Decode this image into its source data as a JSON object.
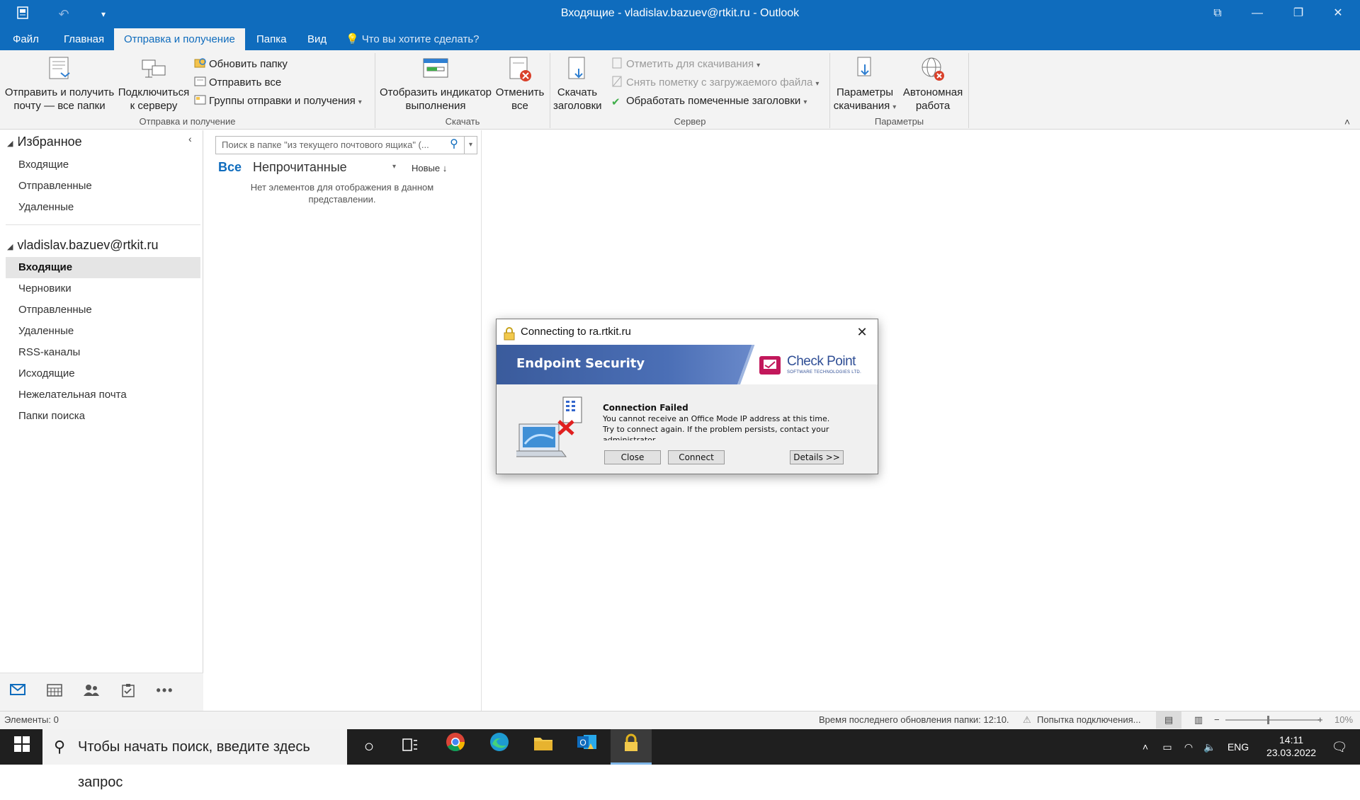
{
  "window": {
    "title": "Входящие - vladislav.bazuev@rtkit.ru - Outlook"
  },
  "ribbon_tabs": [
    {
      "label": "Файл"
    },
    {
      "label": "Главная"
    },
    {
      "label": "Отправка и получение",
      "active": true
    },
    {
      "label": "Папка"
    },
    {
      "label": "Вид"
    }
  ],
  "tell_me": "Что вы хотите сделать?",
  "ribbon": {
    "send_receive_all": "Отправить и получить почту — все папки",
    "send_receive_all_l1": "Отправить и получить",
    "send_receive_all_l2": "почту — все папки",
    "connect_l1": "Подключиться",
    "connect_l2": "к серверу",
    "update_folder": "Обновить папку",
    "send_all": "Отправить все",
    "send_groups": "Группы отправки и получения",
    "group_send_receive": "Отправка и получение",
    "show_progress_l1": "Отобразить индикатор",
    "show_progress_l2": "выполнения",
    "cancel_all_l1": "Отменить",
    "cancel_all_l2": "все",
    "group_download": "Скачать",
    "download_headers_l1": "Скачать",
    "download_headers_l2": "заголовки",
    "mark_download": "Отметить для скачивания",
    "unmark_download": "Снять пометку с загружаемого файла",
    "process_headers": "Обработать помеченные заголовки",
    "group_server": "Сервер",
    "download_prefs_l1": "Параметры",
    "download_prefs_l2": "скачивания",
    "work_offline_l1": "Автономная",
    "work_offline_l2": "работа",
    "group_params": "Параметры"
  },
  "nav": {
    "favorites_header": "Избранное",
    "favorites": [
      "Входящие",
      "Отправленные",
      "Удаленные"
    ],
    "account_header": "vladislav.bazuev@rtkit.ru",
    "folders": [
      "Входящие",
      "Черновики",
      "Отправленные",
      "Удаленные",
      "RSS-каналы",
      "Исходящие",
      "Нежелательная почта",
      "Папки поиска"
    ],
    "selected": "Входящие"
  },
  "msglist": {
    "search_placeholder": "Поиск в папке \"из текущего почтового ящика\" (...",
    "filter_all": "Все",
    "filter_unread": "Непрочитанные",
    "sort": "Новые",
    "empty_text": "Нет элементов для отображения в данном представлении."
  },
  "dialog": {
    "title": "Connecting to ra.rtkit.ru",
    "banner_left": "Endpoint Security",
    "brand": "Check Point",
    "brand_sub": "SOFTWARE TECHNOLOGIES LTD.",
    "heading": "Connection Failed",
    "message_1": "You cannot receive an Office Mode IP address at this time.",
    "message_2": "Try to connect again. If the problem persists, contact your",
    "message_3": "administrator.",
    "btn_close": "Close",
    "btn_connect": "Connect",
    "btn_details": "Details >>"
  },
  "status": {
    "items": "Элементы: 0",
    "last_update": "Время последнего обновления папки: 12:10.",
    "connecting": "Попытка подключения...",
    "zoom": "10%"
  },
  "taskbar": {
    "search_placeholder": "Чтобы начать поиск, введите здесь запрос",
    "lang": "ENG",
    "time": "14:11",
    "date": "23.03.2022"
  },
  "colors": {
    "accent": "#0f6cbd",
    "taskbar": "#1f1f1f",
    "banner": "#3a5b9c"
  }
}
